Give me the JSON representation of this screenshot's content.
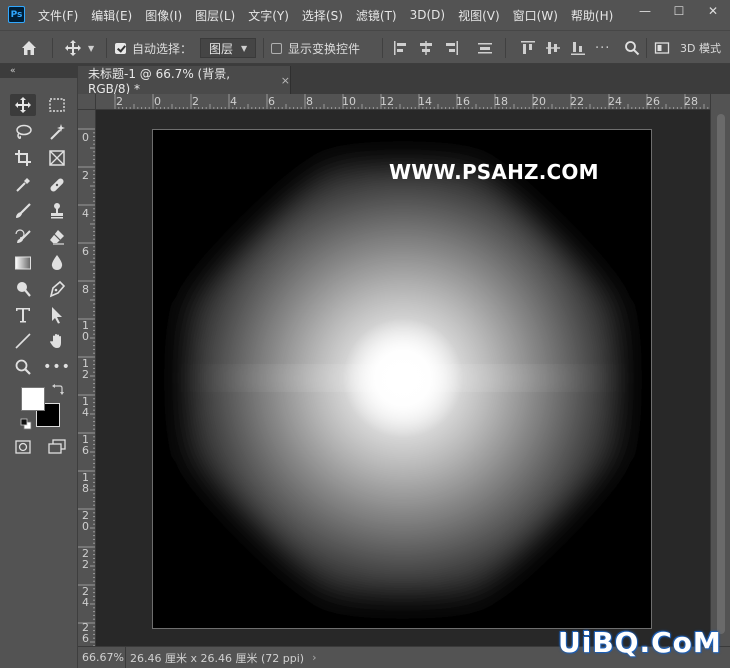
{
  "app": {
    "logo_text": "Ps"
  },
  "menu": {
    "items": [
      "文件(F)",
      "编辑(E)",
      "图像(I)",
      "图层(L)",
      "文字(Y)",
      "选择(S)",
      "滤镜(T)",
      "3D(D)",
      "视图(V)",
      "窗口(W)",
      "帮助(H)"
    ]
  },
  "window_controls": {
    "minimize": "—",
    "maximize": "☐",
    "close": "✕"
  },
  "options_bar": {
    "auto_select_label": "自动选择：",
    "auto_select_checked": true,
    "auto_select_target": "图层",
    "show_transform_label": "显示变换控件",
    "show_transform_checked": false,
    "mode_3d_label": "3D 模式"
  },
  "panel_collapse": "«",
  "document": {
    "tab_title": "未标题-1 @ 66.7% (背景, RGB/8) *",
    "tab_close": "×",
    "watermark_text": "WWW.PSAHZ.COM"
  },
  "rulers": {
    "top": [
      "2",
      "0",
      "2",
      "4",
      "6",
      "8",
      "10",
      "12",
      "14",
      "16",
      "18",
      "20",
      "22",
      "24",
      "26",
      "28"
    ],
    "left": [
      "0",
      "2",
      "4",
      "6",
      "8",
      "1\n0",
      "1\n2",
      "1\n4",
      "1\n6",
      "1\n8",
      "2\n0",
      "2\n2",
      "2\n4",
      "2\n6"
    ]
  },
  "status": {
    "zoom": "66.67%",
    "doc_info": "26.46 厘米 x 26.46 厘米 (72 ppi)",
    "chevron": "›"
  },
  "site_logo": "UiBQ.CoM",
  "colors": {
    "foreground": "#ffffff",
    "background": "#000000",
    "ui_panel": "#535353",
    "workspace": "#282828"
  },
  "tools": [
    "move-tool",
    "marquee-tool",
    "lasso-tool",
    "magic-wand-tool",
    "crop-tool",
    "frame-tool",
    "eyedropper-tool",
    "healing-brush-tool",
    "brush-tool",
    "clone-stamp-tool",
    "history-brush-tool",
    "eraser-tool",
    "gradient-tool",
    "blur-tool",
    "dodge-tool",
    "pen-tool",
    "type-tool",
    "path-selection-tool",
    "line-tool",
    "hand-tool",
    "zoom-tool",
    "more-tools"
  ]
}
